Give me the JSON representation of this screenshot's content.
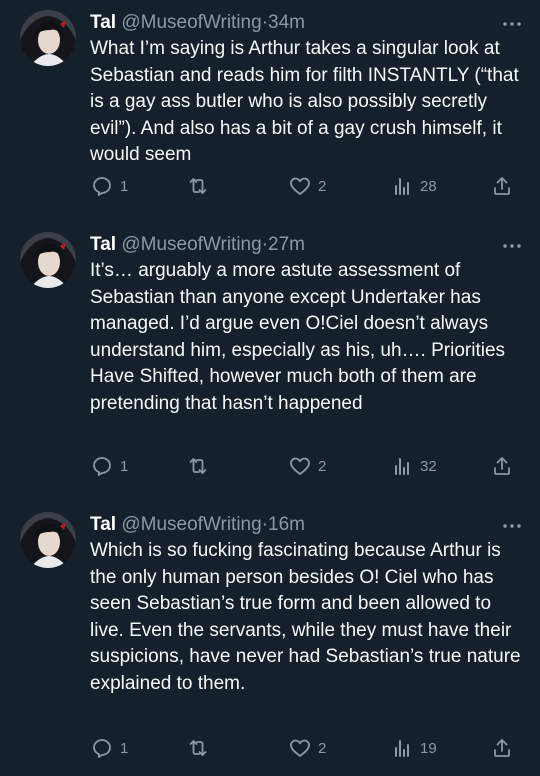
{
  "tweets": [
    {
      "name": "Tal",
      "handle": "@MuseofWriting",
      "separator": "·",
      "time": "34m",
      "text": "What I’m saying is Arthur takes a singular look at Sebastian and reads him for filth INSTANTLY (“that is a gay ass butler who is also possibly secretly evil”). And also has a bit of a gay crush himself, it would seem",
      "replies": "1",
      "retweets": "",
      "likes": "2",
      "views": "28"
    },
    {
      "name": "Tal",
      "handle": "@MuseofWriting",
      "separator": "·",
      "time": "27m",
      "text": "It’s… arguably a more astute assessment of Sebastian than anyone except Undertaker has managed. I’d argue even O!Ciel doesn’t always understand him, especially as his, uh…. Priorities Have Shifted, however much both of them are pretending that hasn’t happened",
      "replies": "1",
      "retweets": "",
      "likes": "2",
      "views": "32"
    },
    {
      "name": "Tal",
      "handle": "@MuseofWriting",
      "separator": "·",
      "time": "16m",
      "text": "Which is so fucking fascinating because Arthur is the only human person besides O! Ciel who has seen Sebastian’s true form and been allowed to live. Even the servants, while they must have their suspicions, have never had Sebastian’s true nature explained to them.",
      "replies": "1",
      "retweets": "",
      "likes": "2",
      "views": "19"
    }
  ],
  "icons": {
    "reply": "reply-icon",
    "retweet": "retweet-icon",
    "like": "heart-icon",
    "views": "views-icon",
    "share": "share-icon",
    "more": "more-icon"
  },
  "colors": {
    "background": "#15202b",
    "text": "#f7f9f9",
    "muted": "#8b98a5"
  }
}
